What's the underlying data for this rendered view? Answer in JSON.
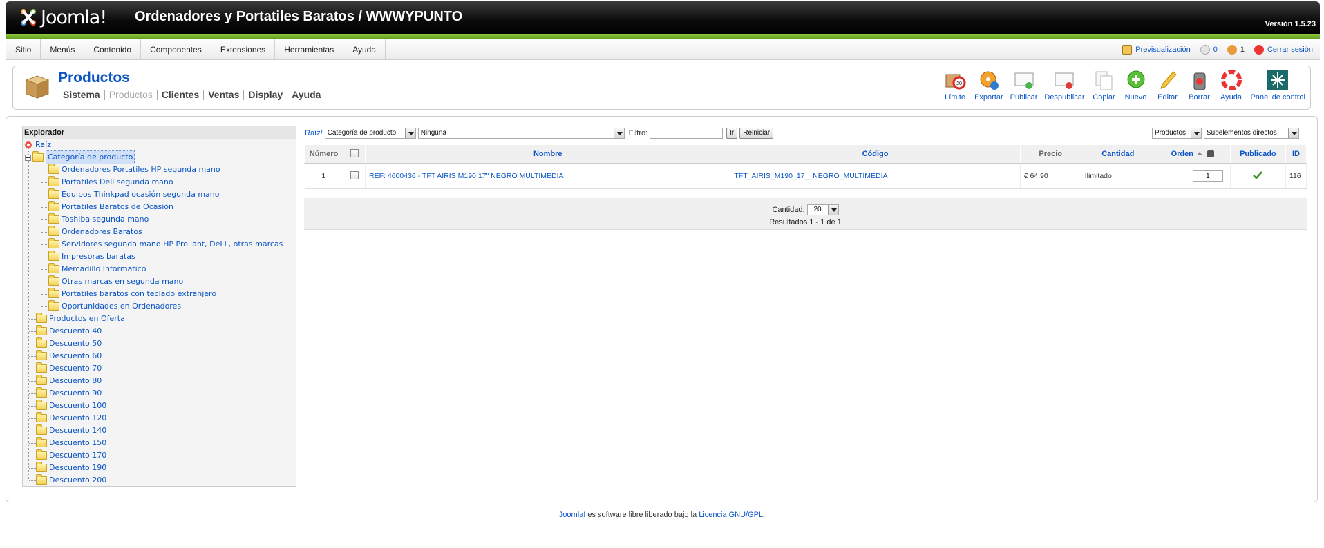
{
  "header": {
    "logo_text": "Joomla!",
    "site_title": "Ordenadores y Portatiles Baratos / WWWYPUNTO",
    "version": "Versión 1.5.23"
  },
  "menu": {
    "items": [
      "Sitio",
      "Menús",
      "Contenido",
      "Componentes",
      "Extensiones",
      "Herramientas",
      "Ayuda"
    ],
    "preview": "Previsualización",
    "messages_count": "0",
    "users_count": "1",
    "logout": "Cerrar sesión"
  },
  "page": {
    "title": "Productos",
    "submenu": [
      "Sistema",
      "Productos",
      "Clientes",
      "Ventas",
      "Display",
      "Ayuda"
    ]
  },
  "toolbar": [
    {
      "label": "Límite",
      "icon": "limit-icon"
    },
    {
      "label": "Exportar",
      "icon": "export-icon"
    },
    {
      "label": "Publicar",
      "icon": "publish-icon"
    },
    {
      "label": "Despublicar",
      "icon": "unpublish-icon"
    },
    {
      "label": "Copiar",
      "icon": "copy-icon"
    },
    {
      "label": "Nuevo",
      "icon": "new-icon"
    },
    {
      "label": "Editar",
      "icon": "edit-icon"
    },
    {
      "label": "Borrar",
      "icon": "delete-icon"
    },
    {
      "label": "Ayuda",
      "icon": "help-icon"
    },
    {
      "label": "Panel de control",
      "icon": "control-panel-icon"
    }
  ],
  "explorer": {
    "title": "Explorador",
    "root": "Raíz",
    "category": "Categoría de producto",
    "subcategories": [
      "Ordenadores Portatiles HP segunda mano",
      "Portatiles Dell segunda mano",
      "Equipos Thinkpad ocasión segunda mano",
      "Portatiles Baratos de Ocasión",
      "Toshiba segunda mano",
      "Ordenadores Baratos",
      "Servidores segunda mano HP Proliant, DeLL, otras marcas",
      "Impresoras baratas",
      "Mercadillo Informatico",
      "Otras marcas en segunda mano",
      "Portatiles baratos con teclado extranjero",
      "Oportunidades en Ordenadores"
    ],
    "top_level": [
      "Productos en Oferta",
      "Descuento 40",
      "Descuento 50",
      "Descuento 60",
      "Descuento 70",
      "Descuento 80",
      "Descuento 90",
      "Descuento 100",
      "Descuento 120",
      "Descuento 140",
      "Descuento 150",
      "Descuento 170",
      "Descuento 190",
      "Descuento 200"
    ]
  },
  "filters": {
    "breadcrumb": "Raíz/",
    "type_select": "Categoría de producto",
    "category_select": "Ninguna",
    "filter_label": "Filtro:",
    "filter_value": "",
    "go_button": "Ir",
    "reset_button": "Reiniciar",
    "view_select": "Productos",
    "scope_select": "Subelementos directos"
  },
  "table": {
    "headers": {
      "number": "Número",
      "name": "Nombre",
      "code": "Código",
      "price": "Precio",
      "quantity": "Cantidad",
      "order": "Orden",
      "published": "Publicado",
      "id": "ID"
    },
    "rows": [
      {
        "number": "1",
        "name": "REF: 4600436 - TFT AIRIS M190 17\" NEGRO MULTIMEDIA",
        "code": "TFT_AIRIS_M190_17__NEGRO_MULTIMEDIA",
        "price": "€ 64,90",
        "quantity": "Ilimitado",
        "order": "1",
        "published": true,
        "id": "116"
      }
    ]
  },
  "pager": {
    "limit_label": "Cantidad:",
    "limit_value": "20",
    "results": "Resultados 1 - 1 de 1"
  },
  "footer": {
    "joomla": "Joomla!",
    "text": " es software libre liberado bajo la ",
    "license": "Licencia GNU/GPL",
    "end": "."
  }
}
